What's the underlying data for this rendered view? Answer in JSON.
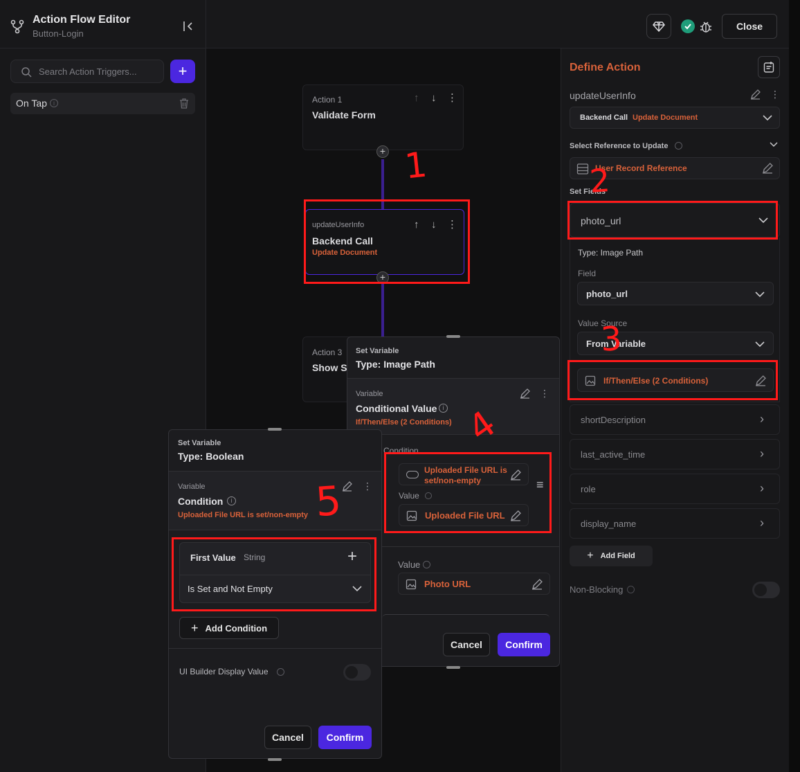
{
  "header": {
    "title": "Action Flow Editor",
    "subtitle": "Button-Login",
    "close_label": "Close"
  },
  "left": {
    "search_placeholder": "Search Action Triggers...",
    "trigger_label": "On Tap"
  },
  "canvas": {
    "action1": {
      "tag": "Action 1",
      "title": "Validate Form"
    },
    "action2": {
      "tag": "updateUserInfo",
      "title": "Backend Call",
      "sub": "Update Document"
    },
    "action3": {
      "tag": "Action 3",
      "title": "Show Sn"
    }
  },
  "right": {
    "title": "Define Action",
    "action_name": "updateUserInfo",
    "call_type": "Backend Call",
    "call_sub": "Update Document",
    "ref_label": "Select Reference to Update",
    "ref_value": "User Record Reference",
    "set_fields_label": "Set Fields",
    "field_selected": "photo_url",
    "type_label": "Type: Image Path",
    "field_label": "Field",
    "field_value": "photo_url",
    "value_source_label": "Value Source",
    "value_source": "From Variable",
    "variable_value": "If/Then/Else (2 Conditions)",
    "fields": [
      "shortDescription",
      "last_active_time",
      "role",
      "display_name"
    ],
    "add_field": "Add Field",
    "non_blocking": "Non-Blocking"
  },
  "popup1": {
    "title_small": "Set Variable",
    "title": "Type: Image Path",
    "var_label": "Variable",
    "var_name": "Conditional Value",
    "var_sub": "If/Then/Else (2 Conditions)",
    "condition_label": "Condition",
    "condition_value_line1": "Uploaded File URL is",
    "condition_value_line2": "set/non-empty",
    "value_label": "Value",
    "value1": "Uploaded File URL",
    "value2": "Photo URL",
    "cancel": "Cancel",
    "confirm": "Confirm"
  },
  "popup2": {
    "title_small": "Set Variable",
    "title": "Type: Boolean",
    "var_label": "Variable",
    "var_name": "Condition",
    "var_sub": "Uploaded File URL is set/non-empty",
    "first_value": "First Value",
    "first_value_type": "String",
    "operator": "Is Set and Not Empty",
    "add_condition": "Add Condition",
    "ui_builder": "UI Builder Display Value",
    "cancel": "Cancel",
    "confirm": "Confirm"
  },
  "annotations": [
    "1",
    "2",
    "3",
    "4",
    "5"
  ],
  "colors": {
    "accent": "#4b27e0",
    "orange": "#d9623a",
    "annotation": "#ff1a1a",
    "success": "#1f9d7a"
  }
}
